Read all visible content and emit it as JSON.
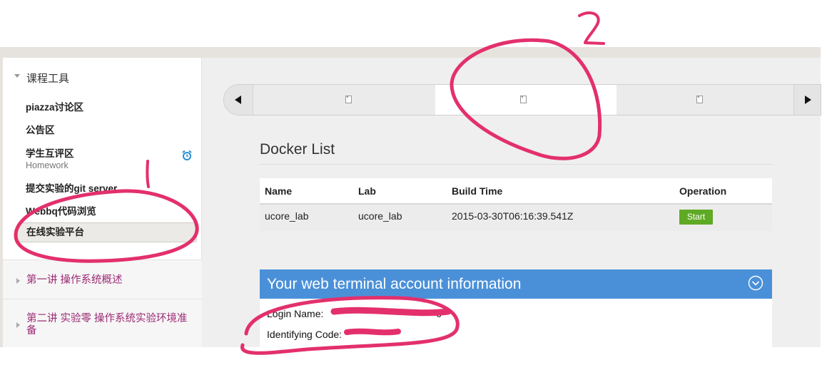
{
  "sidebar": {
    "section_title": "课程工具",
    "items": [
      {
        "label": "piazza讨论区"
      },
      {
        "label": "公告区"
      },
      {
        "label": "学生互评区",
        "sublabel": "Homework"
      },
      {
        "label": "提交实验的git server"
      },
      {
        "label": "Webbq代码浏览"
      },
      {
        "label": "在线实验平台"
      }
    ],
    "lectures": [
      {
        "title": "第一讲 操作系统概述"
      },
      {
        "title": "第二讲 实验零 操作系统实验环境准备"
      }
    ]
  },
  "docker": {
    "title": "Docker List",
    "columns": [
      "Name",
      "Lab",
      "Build Time",
      "Operation"
    ],
    "rows": [
      {
        "name": "ucore_lab",
        "lab": "ucore_lab",
        "build_time": "2015-03-30T06:16:39.541Z",
        "action": "Start"
      }
    ]
  },
  "terminal": {
    "title": "Your web terminal account information",
    "login_label": "Login Name:",
    "login_tail": "0",
    "code_label": "Identifying Code:"
  },
  "annotations": [
    "1",
    "2"
  ],
  "icons": {
    "carousel_prev": "triangle-left-icon",
    "carousel_next": "triangle-right-icon",
    "slot": "document-icon",
    "alarm": "alarm-clock-icon",
    "collapse": "chevron-down-circle-icon"
  },
  "colors": {
    "accent_purple": "#9c2a74",
    "panel_blue": "#4a90d9",
    "start_green": "#5faa24",
    "annotation_pink": "#e3306c"
  }
}
